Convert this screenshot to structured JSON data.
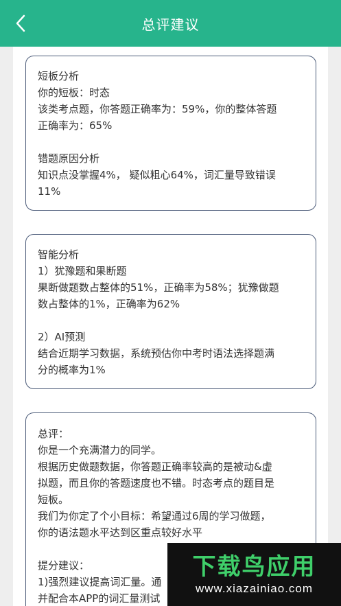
{
  "header": {
    "title": "总评建议"
  },
  "card1": {
    "lines": [
      "短板分析",
      "你的短板：时态",
      "该类考点题，你答题正确率为：59%，你的整体答题",
      "正确率为：65%",
      "错题原因分析",
      "知识点没掌握4%， 疑似粗心64%，词汇量导致错误",
      "11%"
    ]
  },
  "card2": {
    "lines": [
      "智能分析",
      "1）犹豫题和果断题",
      "果断做题数占整体的51%，正确率为58%；犹豫做题",
      "数占整体的1%，正确率为62%",
      "2）AI预测",
      "结合近期学习数据，系统预估你中考时语法选择题满",
      "分的概率为1%"
    ]
  },
  "card3": {
    "lines": [
      "总评：",
      "你是一个充满潜力的同学。",
      "根据历史做题数据，你答题正确率较高的是被动&虚",
      "拟题，而且你的答题速度也不错。时态考点的题目是",
      "短板。",
      "我们为你定了个小目标：希望通过6周的学习做题，",
      "你的语法题水平达到区重点较好水平",
      "提分建议：",
      "1)强烈建议提高词汇量。通",
      "并配合本APP的词汇量测试"
    ]
  },
  "watermark": {
    "main": "下载鸟应用",
    "url": "www.xiazainiao.com"
  },
  "colors": {
    "header": "#27b48c",
    "card_border": "#4a5a78",
    "watermark_text": "#3fcf6a"
  }
}
